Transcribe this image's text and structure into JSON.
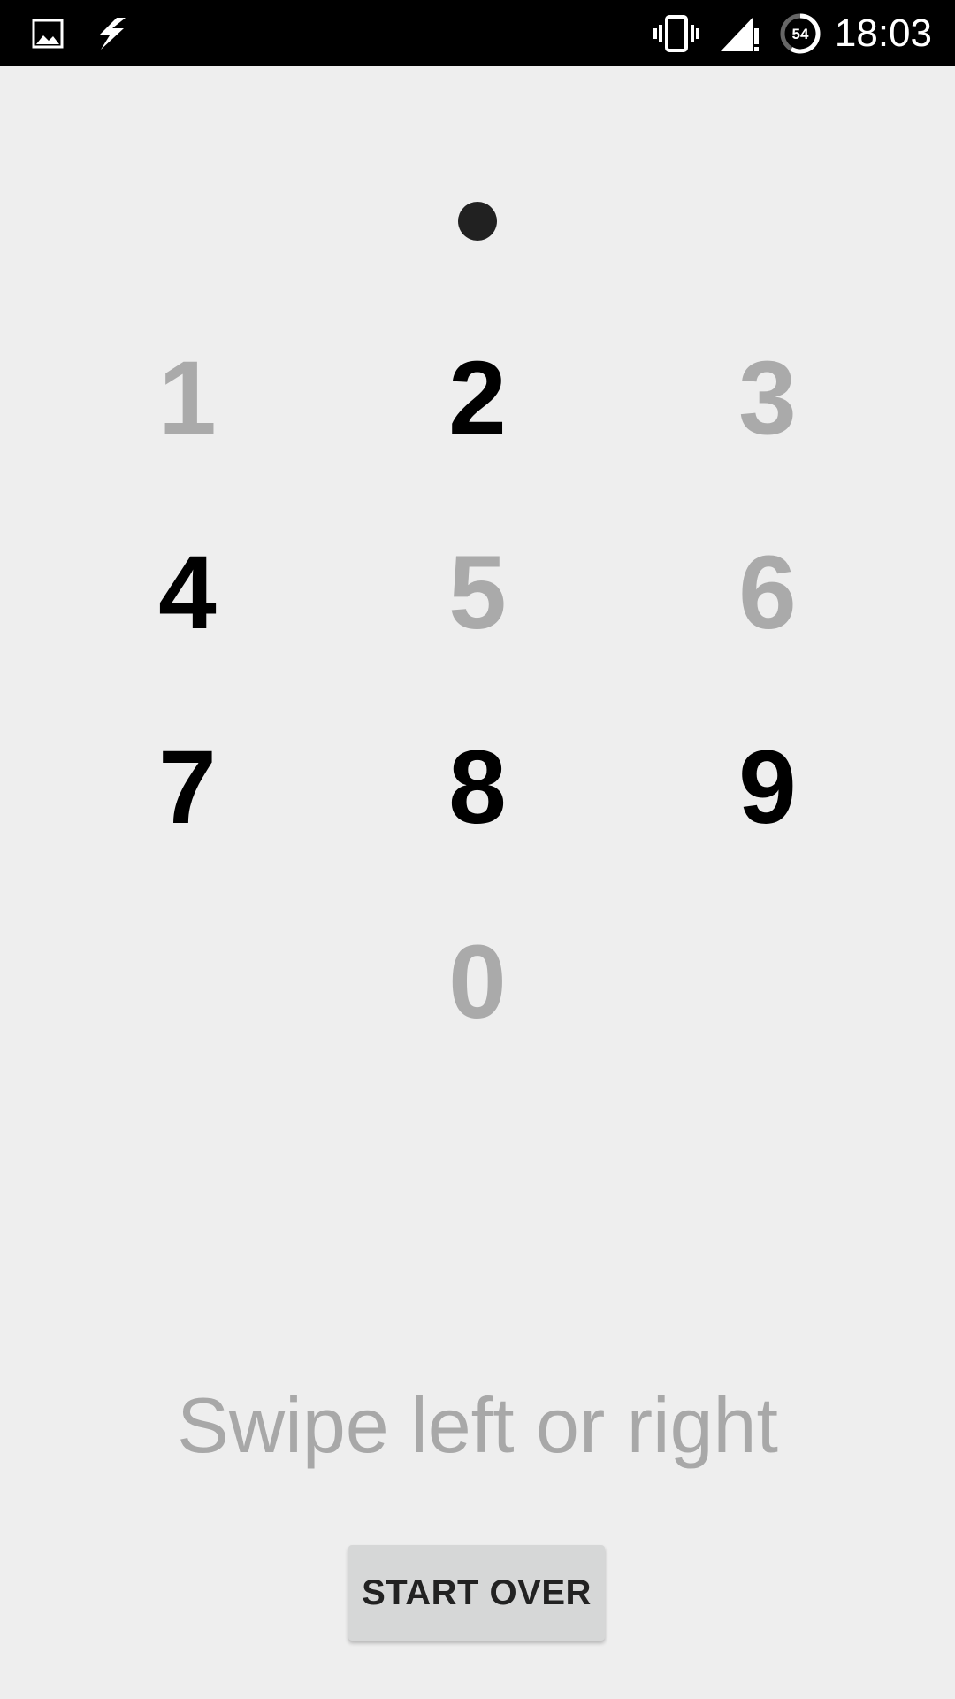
{
  "status_bar": {
    "time": "18:03",
    "battery_percent": "54",
    "icons": [
      "image-icon",
      "flash-icon",
      "vibrate-icon",
      "signal-icon",
      "battery-icon"
    ]
  },
  "pin": {
    "entered_count": 1
  },
  "keypad": {
    "keys": [
      {
        "label": "1",
        "state": "inactive"
      },
      {
        "label": "2",
        "state": "active"
      },
      {
        "label": "3",
        "state": "inactive"
      },
      {
        "label": "4",
        "state": "active"
      },
      {
        "label": "5",
        "state": "inactive"
      },
      {
        "label": "6",
        "state": "inactive"
      },
      {
        "label": "7",
        "state": "active"
      },
      {
        "label": "8",
        "state": "active"
      },
      {
        "label": "9",
        "state": "active"
      },
      {
        "label": "0",
        "state": "inactive"
      }
    ]
  },
  "instruction": "Swipe left or right",
  "start_over_label": "START OVER",
  "colors": {
    "background": "#eeeeee",
    "active_digit": "#000000",
    "inactive_digit": "#aaaaaa",
    "button_bg": "#d6d7d7"
  }
}
